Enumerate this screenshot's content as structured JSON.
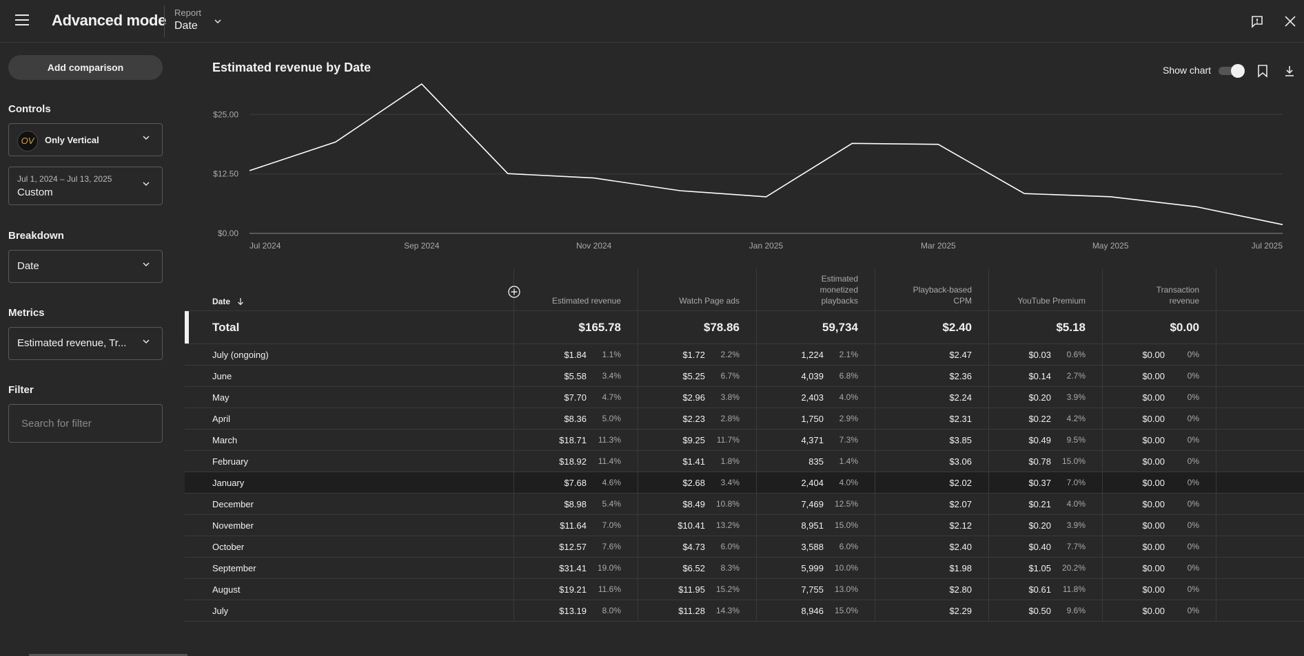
{
  "header": {
    "title": "Advanced mode",
    "report_label": "Report",
    "report_value": "Date"
  },
  "sidebar": {
    "add_comparison": "Add comparison",
    "controls_label": "Controls",
    "channel_logo_text": "OV",
    "channel_name": "Only Vertical",
    "date_range": "Jul 1, 2024 – Jul 13, 2025",
    "date_preset": "Custom",
    "breakdown_label": "Breakdown",
    "breakdown_value": "Date",
    "metrics_label": "Metrics",
    "metrics_value": "Estimated revenue, Tr...",
    "filter_label": "Filter",
    "filter_placeholder": "Search for filter"
  },
  "chart_header": {
    "title": "Estimated revenue by Date",
    "show_chart_label": "Show chart"
  },
  "chart_data": {
    "type": "line",
    "title": "Estimated revenue by Date",
    "xlabel": "",
    "ylabel": "",
    "ylim": [
      0,
      31.41
    ],
    "yticks": [
      {
        "value": 0,
        "label": "$0.00"
      },
      {
        "value": 12.5,
        "label": "$12.50"
      },
      {
        "value": 25,
        "label": "$25.00"
      }
    ],
    "x_tick_labels": [
      "Jul 2024",
      "Sep 2024",
      "Nov 2024",
      "Jan 2025",
      "Mar 2025",
      "May 2025",
      "Jul 2025"
    ],
    "x_tick_index": [
      0,
      2,
      4,
      6,
      8,
      10,
      12
    ],
    "grid": true,
    "legend": "none",
    "line_color": "#ffffff",
    "series": [
      {
        "values": [
          13.19,
          19.21,
          31.41,
          12.57,
          11.64,
          8.98,
          7.68,
          18.92,
          18.71,
          8.36,
          7.7,
          5.58,
          1.84
        ]
      }
    ]
  },
  "table": {
    "columns": [
      {
        "label": "Date"
      },
      {
        "label": "Estimated revenue"
      },
      {
        "label": "Watch Page ads"
      },
      {
        "label": "Estimated monetized playbacks"
      },
      {
        "label": "Playback-based CPM"
      },
      {
        "label": "YouTube Premium"
      },
      {
        "label": "Transaction revenue"
      }
    ],
    "total": {
      "label": "Total",
      "values": [
        "$165.78",
        "$78.86",
        "59,734",
        "$2.40",
        "$5.18",
        "$0.00"
      ]
    },
    "rows": [
      {
        "label": "July (ongoing)",
        "rev": "$1.84",
        "rev_pct": "1.1%",
        "wpa": "$1.72",
        "wpa_pct": "2.2%",
        "mp": "1,224",
        "mp_pct": "2.1%",
        "cpm": "$2.47",
        "ytp": "$0.03",
        "ytp_pct": "0.6%",
        "tr": "$0.00",
        "tr_pct": "0%"
      },
      {
        "label": "June",
        "rev": "$5.58",
        "rev_pct": "3.4%",
        "wpa": "$5.25",
        "wpa_pct": "6.7%",
        "mp": "4,039",
        "mp_pct": "6.8%",
        "cpm": "$2.36",
        "ytp": "$0.14",
        "ytp_pct": "2.7%",
        "tr": "$0.00",
        "tr_pct": "0%"
      },
      {
        "label": "May",
        "rev": "$7.70",
        "rev_pct": "4.7%",
        "wpa": "$2.96",
        "wpa_pct": "3.8%",
        "mp": "2,403",
        "mp_pct": "4.0%",
        "cpm": "$2.24",
        "ytp": "$0.20",
        "ytp_pct": "3.9%",
        "tr": "$0.00",
        "tr_pct": "0%"
      },
      {
        "label": "April",
        "rev": "$8.36",
        "rev_pct": "5.0%",
        "wpa": "$2.23",
        "wpa_pct": "2.8%",
        "mp": "1,750",
        "mp_pct": "2.9%",
        "cpm": "$2.31",
        "ytp": "$0.22",
        "ytp_pct": "4.2%",
        "tr": "$0.00",
        "tr_pct": "0%"
      },
      {
        "label": "March",
        "rev": "$18.71",
        "rev_pct": "11.3%",
        "wpa": "$9.25",
        "wpa_pct": "11.7%",
        "mp": "4,371",
        "mp_pct": "7.3%",
        "cpm": "$3.85",
        "ytp": "$0.49",
        "ytp_pct": "9.5%",
        "tr": "$0.00",
        "tr_pct": "0%"
      },
      {
        "label": "February",
        "rev": "$18.92",
        "rev_pct": "11.4%",
        "wpa": "$1.41",
        "wpa_pct": "1.8%",
        "mp": "835",
        "mp_pct": "1.4%",
        "cpm": "$3.06",
        "ytp": "$0.78",
        "ytp_pct": "15.0%",
        "tr": "$0.00",
        "tr_pct": "0%"
      },
      {
        "label": "January",
        "rev": "$7.68",
        "rev_pct": "4.6%",
        "wpa": "$2.68",
        "wpa_pct": "3.4%",
        "mp": "2,404",
        "mp_pct": "4.0%",
        "cpm": "$2.02",
        "ytp": "$0.37",
        "ytp_pct": "7.0%",
        "tr": "$0.00",
        "tr_pct": "0%"
      },
      {
        "label": "December",
        "rev": "$8.98",
        "rev_pct": "5.4%",
        "wpa": "$8.49",
        "wpa_pct": "10.8%",
        "mp": "7,469",
        "mp_pct": "12.5%",
        "cpm": "$2.07",
        "ytp": "$0.21",
        "ytp_pct": "4.0%",
        "tr": "$0.00",
        "tr_pct": "0%"
      },
      {
        "label": "November",
        "rev": "$11.64",
        "rev_pct": "7.0%",
        "wpa": "$10.41",
        "wpa_pct": "13.2%",
        "mp": "8,951",
        "mp_pct": "15.0%",
        "cpm": "$2.12",
        "ytp": "$0.20",
        "ytp_pct": "3.9%",
        "tr": "$0.00",
        "tr_pct": "0%"
      },
      {
        "label": "October",
        "rev": "$12.57",
        "rev_pct": "7.6%",
        "wpa": "$4.73",
        "wpa_pct": "6.0%",
        "mp": "3,588",
        "mp_pct": "6.0%",
        "cpm": "$2.40",
        "ytp": "$0.40",
        "ytp_pct": "7.7%",
        "tr": "$0.00",
        "tr_pct": "0%"
      },
      {
        "label": "September",
        "rev": "$31.41",
        "rev_pct": "19.0%",
        "wpa": "$6.52",
        "wpa_pct": "8.3%",
        "mp": "5,999",
        "mp_pct": "10.0%",
        "cpm": "$1.98",
        "ytp": "$1.05",
        "ytp_pct": "20.2%",
        "tr": "$0.00",
        "tr_pct": "0%"
      },
      {
        "label": "August",
        "rev": "$19.21",
        "rev_pct": "11.6%",
        "wpa": "$11.95",
        "wpa_pct": "15.2%",
        "mp": "7,755",
        "mp_pct": "13.0%",
        "cpm": "$2.80",
        "ytp": "$0.61",
        "ytp_pct": "11.8%",
        "tr": "$0.00",
        "tr_pct": "0%"
      },
      {
        "label": "July",
        "rev": "$13.19",
        "rev_pct": "8.0%",
        "wpa": "$11.28",
        "wpa_pct": "14.3%",
        "mp": "8,946",
        "mp_pct": "15.0%",
        "cpm": "$2.29",
        "ytp": "$0.50",
        "ytp_pct": "9.6%",
        "tr": "$0.00",
        "tr_pct": "0%"
      }
    ]
  }
}
